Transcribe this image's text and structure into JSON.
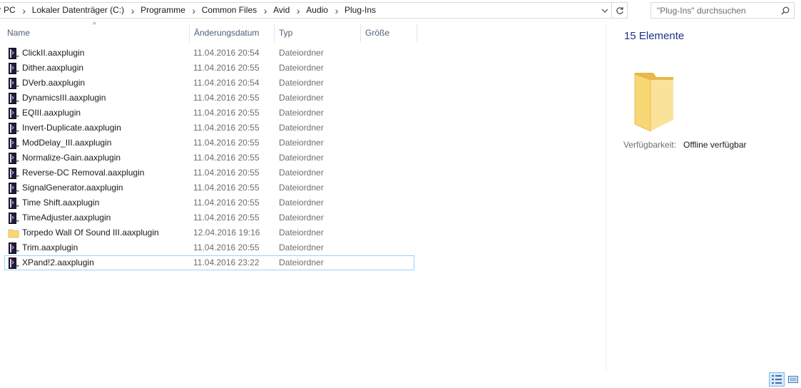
{
  "breadcrumb": [
    "er PC",
    "Lokaler Datenträger (C:)",
    "Programme",
    "Common Files",
    "Avid",
    "Audio",
    "Plug-Ins"
  ],
  "search": {
    "placeholder": "\"Plug-Ins\" durchsuchen"
  },
  "columns": {
    "name": "Name",
    "date": "Änderungsdatum",
    "type": "Typ",
    "size": "Größe"
  },
  "files": [
    {
      "name": "ClickII.aaxplugin",
      "date": "11.04.2016 20:54",
      "type": "Dateiordner",
      "icon": "plugin-folder-icon"
    },
    {
      "name": "Dither.aaxplugin",
      "date": "11.04.2016 20:55",
      "type": "Dateiordner",
      "icon": "plugin-folder-icon"
    },
    {
      "name": "DVerb.aaxplugin",
      "date": "11.04.2016 20:54",
      "type": "Dateiordner",
      "icon": "plugin-folder-icon"
    },
    {
      "name": "DynamicsIII.aaxplugin",
      "date": "11.04.2016 20:55",
      "type": "Dateiordner",
      "icon": "plugin-folder-icon"
    },
    {
      "name": "EQIII.aaxplugin",
      "date": "11.04.2016 20:55",
      "type": "Dateiordner",
      "icon": "plugin-folder-icon"
    },
    {
      "name": "Invert-Duplicate.aaxplugin",
      "date": "11.04.2016 20:55",
      "type": "Dateiordner",
      "icon": "plugin-folder-icon"
    },
    {
      "name": "ModDelay_III.aaxplugin",
      "date": "11.04.2016 20:55",
      "type": "Dateiordner",
      "icon": "plugin-folder-icon"
    },
    {
      "name": "Normalize-Gain.aaxplugin",
      "date": "11.04.2016 20:55",
      "type": "Dateiordner",
      "icon": "plugin-folder-icon"
    },
    {
      "name": "Reverse-DC Removal.aaxplugin",
      "date": "11.04.2016 20:55",
      "type": "Dateiordner",
      "icon": "plugin-folder-icon"
    },
    {
      "name": "SignalGenerator.aaxplugin",
      "date": "11.04.2016 20:55",
      "type": "Dateiordner",
      "icon": "plugin-folder-icon"
    },
    {
      "name": "Time Shift.aaxplugin",
      "date": "11.04.2016 20:55",
      "type": "Dateiordner",
      "icon": "plugin-folder-icon"
    },
    {
      "name": "TimeAdjuster.aaxplugin",
      "date": "11.04.2016 20:55",
      "type": "Dateiordner",
      "icon": "plugin-folder-icon"
    },
    {
      "name": "Torpedo Wall Of Sound III.aaxplugin",
      "date": "12.04.2016 19:16",
      "type": "Dateiordner",
      "icon": "folder-icon"
    },
    {
      "name": "Trim.aaxplugin",
      "date": "11.04.2016 20:55",
      "type": "Dateiordner",
      "icon": "plugin-folder-icon"
    },
    {
      "name": "XPand!2.aaxplugin",
      "date": "11.04.2016 23:22",
      "type": "Dateiordner",
      "icon": "plugin-folder-icon",
      "focused": true
    }
  ],
  "details": {
    "count": "15 Elemente",
    "availability_label": "Verfügbarkeit:",
    "availability_value": "Offline verfügbar"
  },
  "colors": {
    "header_text": "#4c607a",
    "count_text": "#1e3287",
    "focus_border": "#99d1ff",
    "folder_yellow": "#f8d775"
  }
}
